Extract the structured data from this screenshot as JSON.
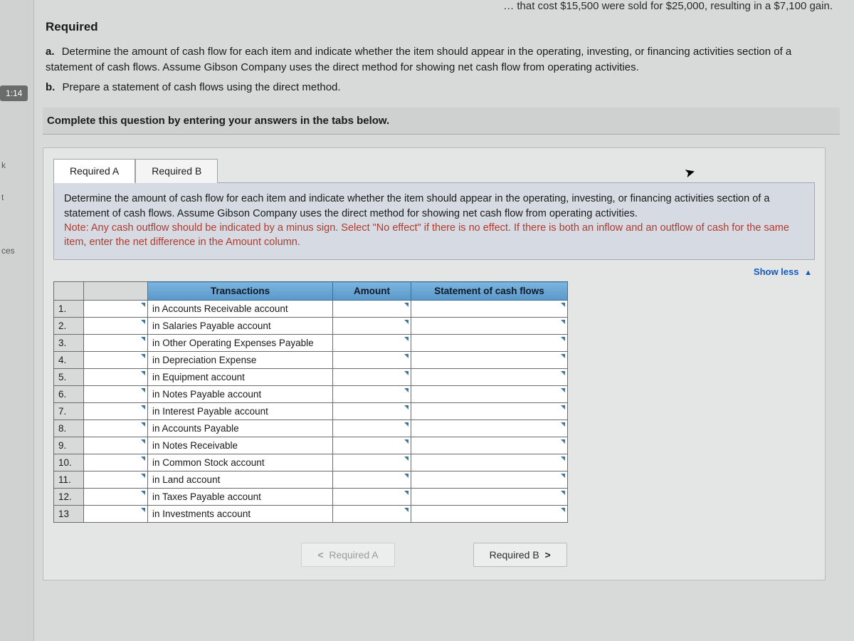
{
  "top_fragment": "… that cost $15,500 were sold for $25,000, resulting in a $7,100 gain.",
  "timer": "1:14",
  "rail": {
    "k": "k",
    "t": "t",
    "ces": "ces"
  },
  "required_heading": "Required",
  "requirements": {
    "a_label": "a.",
    "a_text": "Determine the amount of cash flow for each item and indicate whether the item should appear in the operating, investing, or financing activities section of a statement of cash flows. Assume Gibson Company uses the direct method for showing net cash flow from operating activities.",
    "b_label": "b.",
    "b_text": "Prepare a statement of cash flows using the direct method."
  },
  "instruction": "Complete this question by entering your answers in the tabs below.",
  "tabs": {
    "a": "Required A",
    "b": "Required B"
  },
  "prompt_main": "Determine the amount of cash flow for each item and indicate whether the item should appear in the operating, investing, or financing activities section of a statement of cash flows. Assume Gibson Company uses the direct method for showing net cash flow from operating activities.",
  "prompt_note": "Note: Any cash outflow should be indicated by a minus sign. Select \"No effect\" if there is no effect. If there is both an inflow and an outflow of cash for the same item, enter the net difference in the Amount column.",
  "show_less": "Show less",
  "table": {
    "headers": {
      "transactions": "Transactions",
      "amount": "Amount",
      "statement": "Statement of cash flows"
    },
    "rows": [
      {
        "n": "1.",
        "txn": "in Accounts Receivable account"
      },
      {
        "n": "2.",
        "txn": "in Salaries Payable account"
      },
      {
        "n": "3.",
        "txn": "in Other Operating Expenses Payable"
      },
      {
        "n": "4.",
        "txn": "in Depreciation Expense"
      },
      {
        "n": "5.",
        "txn": "in Equipment account"
      },
      {
        "n": "6.",
        "txn": "in Notes Payable account"
      },
      {
        "n": "7.",
        "txn": "in Interest Payable account"
      },
      {
        "n": "8.",
        "txn": "in Accounts Payable"
      },
      {
        "n": "9.",
        "txn": "in Notes Receivable"
      },
      {
        "n": "10.",
        "txn": "in Common Stock account"
      },
      {
        "n": "11.",
        "txn": "in Land account"
      },
      {
        "n": "12.",
        "txn": "in Taxes Payable account"
      },
      {
        "n": "13",
        "txn": "in Investments account"
      }
    ]
  },
  "nav": {
    "prev": "Required A",
    "next": "Required B"
  }
}
